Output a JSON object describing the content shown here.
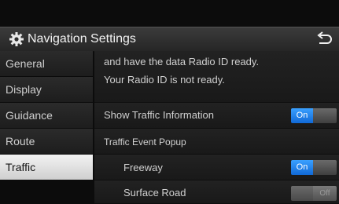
{
  "header": {
    "title": "Navigation Settings",
    "back_icon": "back-arrow-icon",
    "settings_icon": "gear-icon"
  },
  "sidebar": {
    "items": [
      {
        "label": "General",
        "active": false
      },
      {
        "label": "Display",
        "active": false
      },
      {
        "label": "Guidance",
        "active": false
      },
      {
        "label": "Route",
        "active": false
      },
      {
        "label": "Traffic",
        "active": true
      }
    ]
  },
  "content": {
    "info_line1": "and have the data Radio ID ready.",
    "info_line2": "Your Radio ID is not ready.",
    "show_traffic": {
      "label": "Show Traffic Information",
      "toggle": "On"
    },
    "event_popup": {
      "label": "Traffic Event Popup"
    },
    "freeway": {
      "label": "Freeway",
      "toggle": "On"
    },
    "surface_road": {
      "label": "Surface Road",
      "toggle": "Off"
    }
  },
  "colors": {
    "toggle_on": "#1e7ff0",
    "active_tab": "#e6e6e6"
  }
}
